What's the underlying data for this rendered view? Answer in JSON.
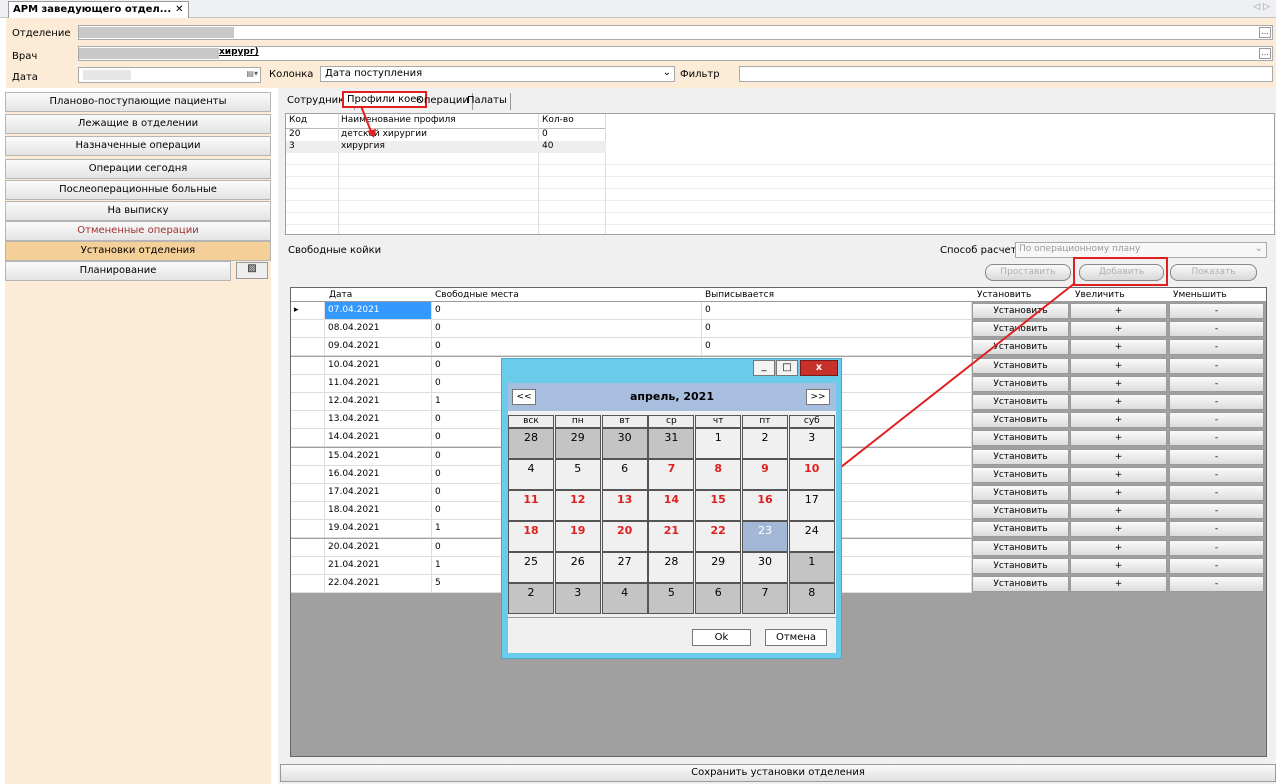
{
  "window_tab": {
    "title": "АРМ заведующего отдел...",
    "close": "✕"
  },
  "form": {
    "department_label": "Отделение",
    "doctor_label": "Врач",
    "doctor_value": "хирург)",
    "date_label": "Дата",
    "column_label": "Колонка",
    "column_value": "Дата поступления",
    "filter_label": "Фильтр",
    "filter_value": ""
  },
  "sidebar": {
    "items": [
      "Планово-поступающие пациенты",
      "Лежащие в отделении",
      "Назначенные операции",
      "Операции сегодня",
      "Послеоперационные больные",
      "На выписку",
      "Отмененные операции",
      "Установки отделения",
      "Планирование"
    ]
  },
  "tabs": [
    "Сотрудники",
    "Профили коек",
    "Операции",
    "Палаты"
  ],
  "profiles": {
    "headers": [
      "Код",
      "Наименование профиля",
      "Кол-во"
    ],
    "rows": [
      [
        "20",
        "детской хирургии",
        "0"
      ],
      [
        "3",
        "хирургия",
        "40"
      ]
    ]
  },
  "free_beds": {
    "label": "Свободные койки",
    "calc_label": "Способ расчета",
    "calc_value": "По операционному плану",
    "btn_set": "Проставить",
    "btn_add": "Добавить",
    "btn_show": "Показать",
    "headers": [
      "Дата",
      "Свободные места",
      "Выписывается",
      "Установить",
      "Увеличить",
      "Уменьшить"
    ],
    "rows": [
      [
        "07.04.2021",
        "0",
        "0"
      ],
      [
        "08.04.2021",
        "0",
        "0"
      ],
      [
        "09.04.2021",
        "0",
        "0"
      ],
      [
        "10.04.2021",
        "0",
        ""
      ],
      [
        "11.04.2021",
        "0",
        ""
      ],
      [
        "12.04.2021",
        "1",
        ""
      ],
      [
        "13.04.2021",
        "0",
        ""
      ],
      [
        "14.04.2021",
        "0",
        ""
      ],
      [
        "15.04.2021",
        "0",
        ""
      ],
      [
        "16.04.2021",
        "0",
        ""
      ],
      [
        "17.04.2021",
        "0",
        ""
      ],
      [
        "18.04.2021",
        "0",
        ""
      ],
      [
        "19.04.2021",
        "1",
        ""
      ],
      [
        "20.04.2021",
        "0",
        ""
      ],
      [
        "21.04.2021",
        "1",
        ""
      ],
      [
        "22.04.2021",
        "5",
        ""
      ]
    ],
    "set_btn": "Установить",
    "inc_btn": "+",
    "dec_btn": "-"
  },
  "save_button": "Сохранить установки отделения",
  "calendar": {
    "month": "апрель, 2021",
    "prev": "<<",
    "next": ">>",
    "weekdays": [
      "вск",
      "пн",
      "вт",
      "ср",
      "чт",
      "пт",
      "суб"
    ],
    "days": [
      [
        "28",
        "29",
        "30",
        "31",
        "1",
        "2",
        "3"
      ],
      [
        "4",
        "5",
        "6",
        "7",
        "8",
        "9",
        "10"
      ],
      [
        "11",
        "12",
        "13",
        "14",
        "15",
        "16",
        "17"
      ],
      [
        "18",
        "19",
        "20",
        "21",
        "22",
        "23",
        "24"
      ],
      [
        "25",
        "26",
        "27",
        "28",
        "29",
        "30",
        "1"
      ],
      [
        "2",
        "3",
        "4",
        "5",
        "6",
        "7",
        "8"
      ]
    ],
    "ok": "Ok",
    "cancel": "Отмена",
    "minimize": "_",
    "maximize": "□",
    "close": "x"
  },
  "colors": {
    "accent_red": "#e02020",
    "peach": "#fcebd6",
    "calendar_frame": "#6acbea",
    "selected_day": "#a3b8d6"
  }
}
